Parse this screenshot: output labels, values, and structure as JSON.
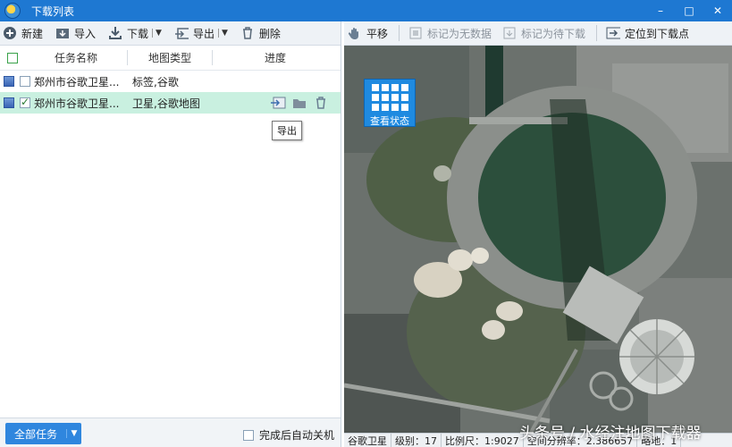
{
  "window": {
    "title": "下载列表",
    "minimize": "–",
    "maximize": "□",
    "close": "✕"
  },
  "toolbar": {
    "new": "新建",
    "import": "导入",
    "download": "下载",
    "export": "导出",
    "delete": "删除"
  },
  "grid": {
    "headers": {
      "name": "任务名称",
      "type": "地图类型",
      "progress": "进度"
    },
    "rows": [
      {
        "name": "郑州市谷歌卫星...",
        "type": "标签,谷歌",
        "checked": false,
        "selected": false
      },
      {
        "name": "郑州市谷歌卫星...",
        "type": "卫星,谷歌地图",
        "checked": true,
        "selected": true
      }
    ]
  },
  "tooltip": {
    "text": "导出"
  },
  "footer": {
    "all_tasks": "全部任务",
    "auto_shutdown": "完成后自动关机"
  },
  "map_toolbar": {
    "pan": "平移",
    "mark_no_data": "标记为无数据",
    "mark_pending": "标记为待下载",
    "locate": "定位到下载点"
  },
  "map": {
    "status_button": "查看状态"
  },
  "map_status": {
    "source": "谷歌卫星",
    "level": "级别：17",
    "scale": "比例尺：1:9027",
    "resolution": "空间分辨率：2.386657",
    "extra": "略地：1"
  },
  "watermark": "头条号 / 水经注地图下载器",
  "colors": {
    "title_bar": "#1e78d2",
    "selected_row": "#c9f0e0",
    "accent": "#2f86de"
  }
}
